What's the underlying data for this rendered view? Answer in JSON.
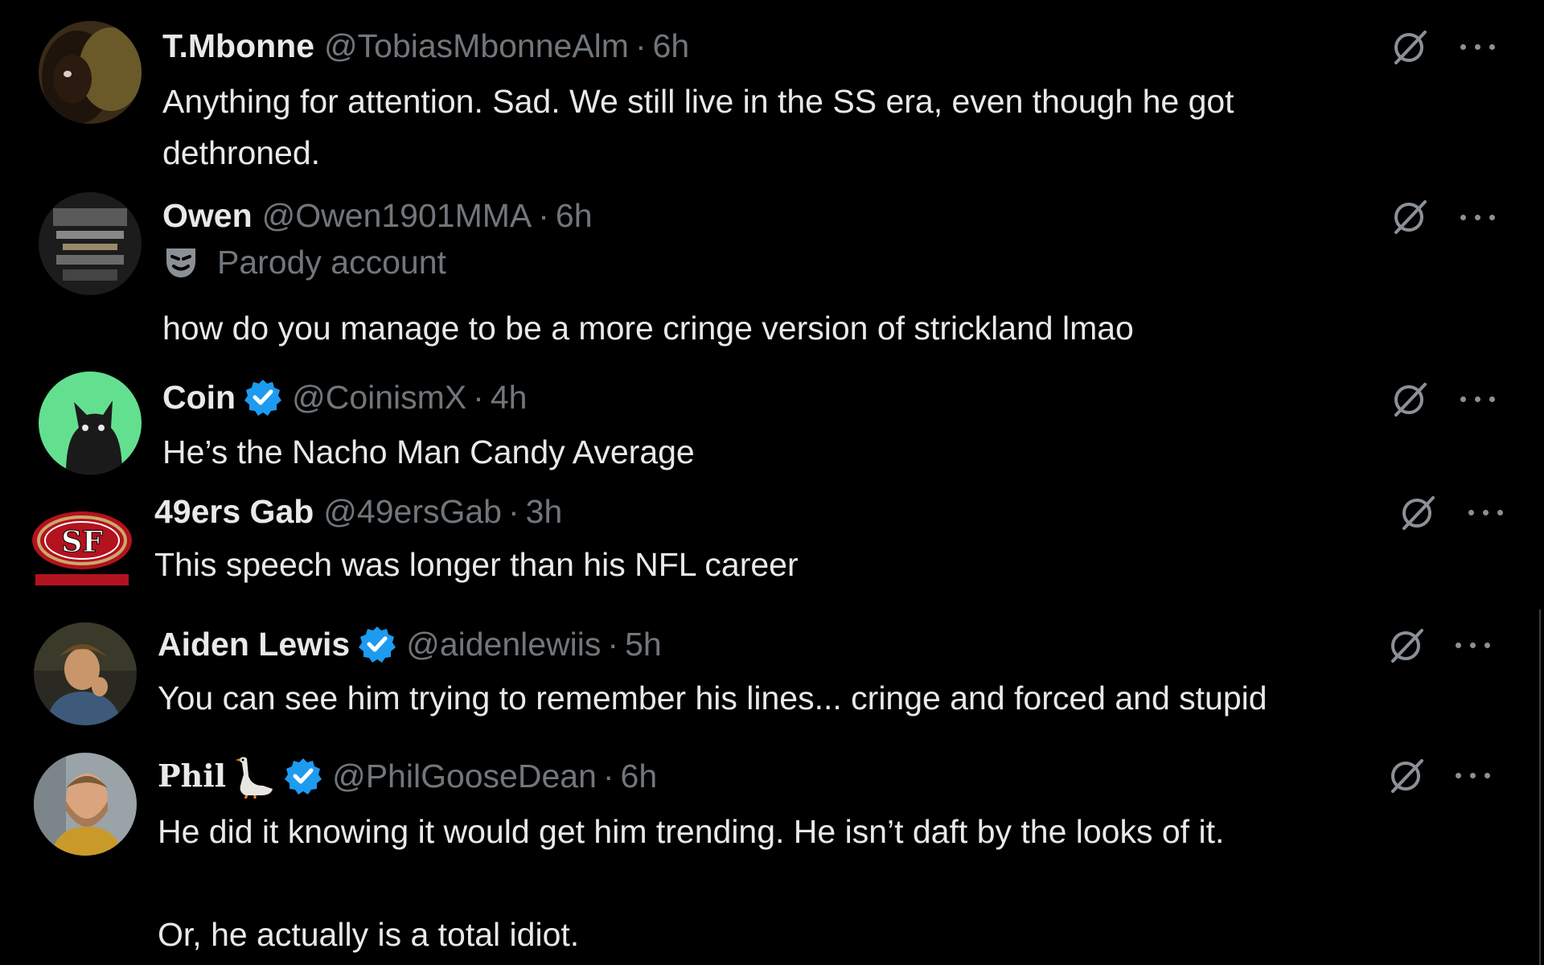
{
  "replies": [
    {
      "name": "T.Mbonne",
      "handle": "@TobiasMbonneAlm",
      "separator": "·",
      "time": "6h",
      "text": "Anything for attention. Sad. We still live in the SS era, even though he got\ndethroned.",
      "verified": false
    },
    {
      "name": "Owen",
      "handle": "@Owen1901MMA",
      "separator": "·",
      "time": "6h",
      "label": "Parody account",
      "text": "how do you manage to be a more cringe version of strickland lmao",
      "verified": false
    },
    {
      "name": "Coin",
      "handle": "@CoinismX",
      "separator": "·",
      "time": "4h",
      "text": "He’s the Nacho Man Candy Average",
      "verified": true
    },
    {
      "name": "49ers Gab",
      "handle": "@49ersGab",
      "separator": "·",
      "time": "3h",
      "text": "This speech was longer than his NFL career",
      "verified": false
    },
    {
      "name": "Aiden Lewis",
      "handle": "@aidenlewiis",
      "separator": "·",
      "time": "5h",
      "text": "You can see him trying to remember his lines... cringe and forced and stupid",
      "verified": true
    },
    {
      "name": "Phil",
      "handle": "@PhilGooseDean",
      "separator": "·",
      "time": "6h",
      "text": "He did it knowing it would get him trending. He isn’t daft by the looks of it.\n\nOr, he actually is a total idiot.",
      "verified": true,
      "name_emoji": "goose-emoji"
    }
  ],
  "icons": {
    "grok": "grok-icon",
    "more": "more-options-icon",
    "verified": "verified-badge-icon",
    "parody": "parody-mask-icon"
  },
  "colors": {
    "background": "#000000",
    "text": "#e7e9ea",
    "secondary": "#71767b",
    "verified": "#1d9bf0"
  }
}
